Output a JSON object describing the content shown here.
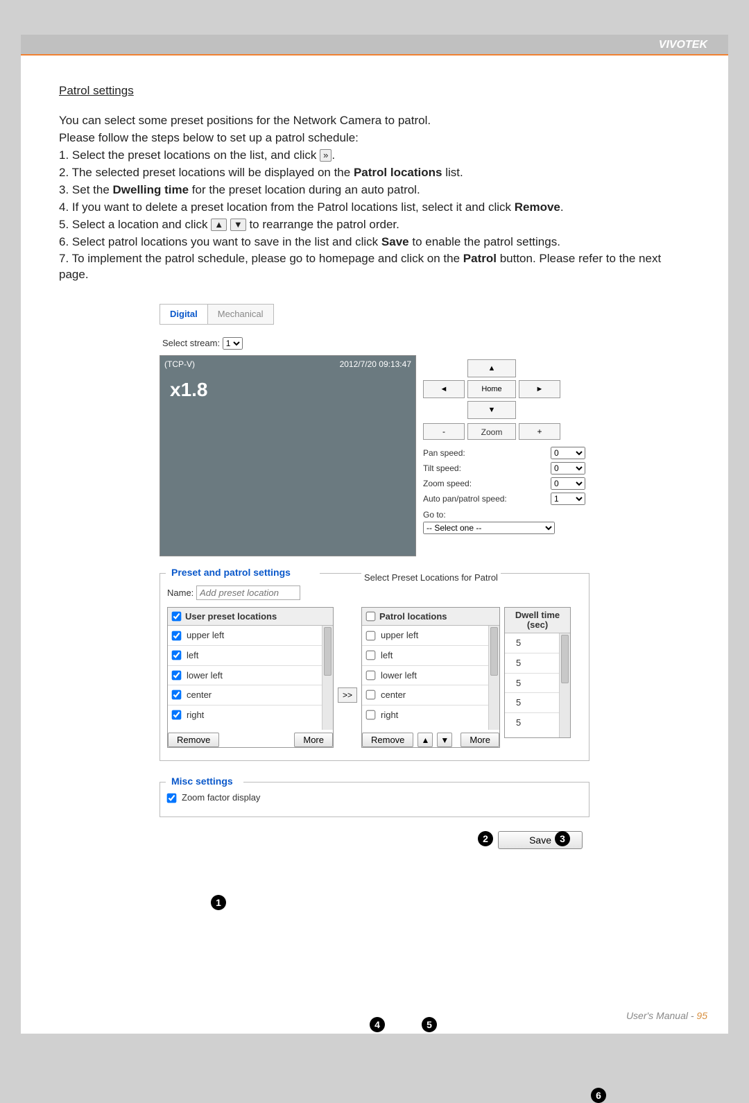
{
  "brand": "VIVOTEK",
  "section_title": "Patrol settings",
  "intro1": "You can select some preset positions for the Network Camera to patrol.",
  "intro2": "Please follow the steps below to set up a patrol schedule:",
  "step1a": "1. Select the preset locations on the list, and click ",
  "step1b": ".",
  "step2a": "2. The selected preset locations will be displayed on the ",
  "step2b": "Patrol locations",
  "step2c": " list.",
  "step3a": "3. Set the ",
  "step3b": "Dwelling time",
  "step3c": " for the preset location during an auto patrol.",
  "step4a": "4. If you want to delete a preset location from the Patrol locations list, select it and click ",
  "step4b": "Remove",
  "step4c": ".",
  "step5a": "5. Select a location and click ",
  "step5b": " to rearrange the patrol order.",
  "step6a": "6. Select patrol locations you want to save in the list and click ",
  "step6b": "Save",
  "step6c": " to enable the patrol settings.",
  "step7a": "7. To implement the patrol schedule, please go to homepage and click on the ",
  "step7b": "Patrol",
  "step7c": " button. Please refer to the next page.",
  "tabs": {
    "digital": "Digital",
    "mechanical": "Mechanical"
  },
  "stream_label": "Select stream:",
  "stream_value": "1",
  "video": {
    "protocol": "(TCP-V)",
    "timestamp": "2012/7/20 09:13:47",
    "zoom": "x1.8"
  },
  "dpad": {
    "up": "▲",
    "down": "▼",
    "left": "◄",
    "right": "►",
    "home": "Home"
  },
  "zoom": {
    "minus": "-",
    "label": "Zoom",
    "plus": "+"
  },
  "speeds": {
    "pan_label": "Pan speed:",
    "pan_value": "0",
    "tilt_label": "Tilt speed:",
    "tilt_value": "0",
    "zoom_label": "Zoom speed:",
    "zoom_value": "0",
    "auto_label": "Auto pan/patrol speed:",
    "auto_value": "1"
  },
  "goto_label": "Go to:",
  "goto_value": "-- Select one --",
  "preset_legend": "Preset and patrol settings",
  "name_label": "Name:",
  "name_placeholder": "Add preset location",
  "select_patrol_label": "Select Preset Locations for Patrol",
  "list1_header": "User preset locations",
  "list2_header": "Patrol locations",
  "list3_header1": "Dwell time",
  "list3_header2": "(sec)",
  "preset_items": [
    "upper left",
    "left",
    "lower left",
    "center",
    "right"
  ],
  "patrol_items": [
    "upper left",
    "left",
    "lower left",
    "center",
    "right"
  ],
  "dwell_values": [
    "5",
    "5",
    "5",
    "5",
    "5"
  ],
  "remove_btn": "Remove",
  "more_btn": "More",
  "transfer_btn": ">>",
  "reorder_up": "▲",
  "reorder_down": "▼",
  "misc_legend": "Misc settings",
  "misc_check_label": "Zoom factor display",
  "save_btn": "Save",
  "callouts": {
    "c1": "1",
    "c2": "2",
    "c3": "3",
    "c4": "4",
    "c5": "5",
    "c6": "6"
  },
  "footer_label": "User's Manual - ",
  "footer_page": "95"
}
